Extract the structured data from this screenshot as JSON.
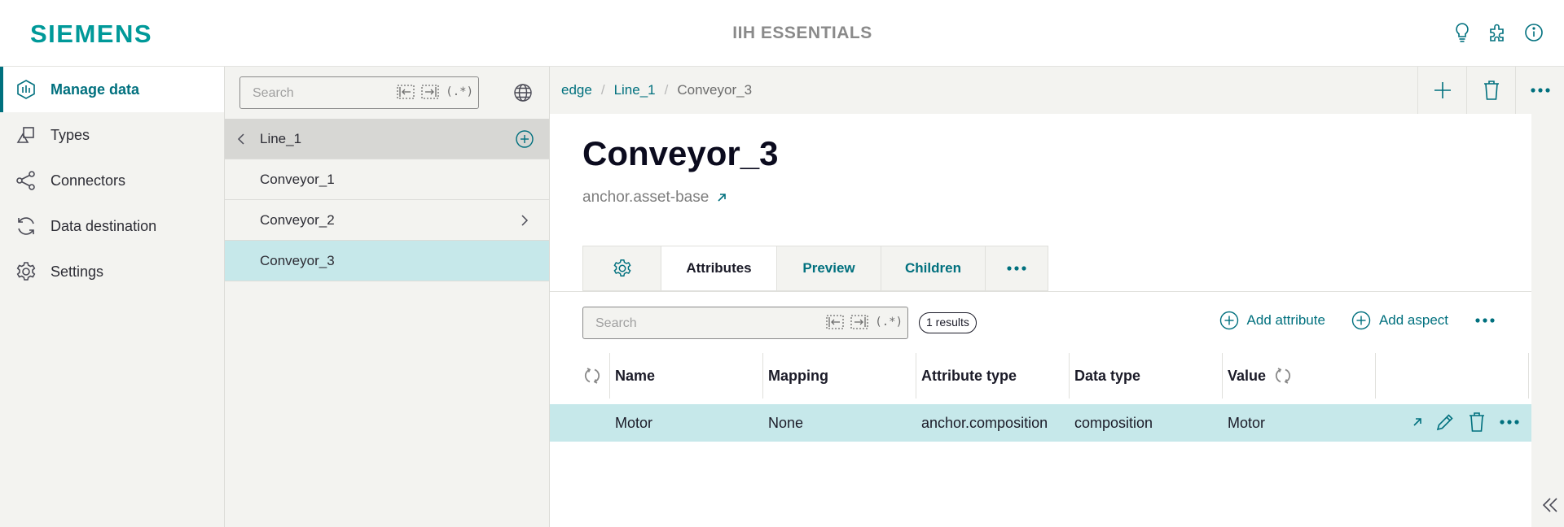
{
  "header": {
    "logo": "SIEMENS",
    "app_title": "IIH ESSENTIALS",
    "icons": [
      "lightbulb-icon",
      "puzzle-icon",
      "info-icon"
    ]
  },
  "nav": {
    "items": [
      {
        "label": "Manage data",
        "icon": "manage-data-icon",
        "active": true
      },
      {
        "label": "Types",
        "icon": "types-icon"
      },
      {
        "label": "Connectors",
        "icon": "connectors-icon"
      },
      {
        "label": "Data destination",
        "icon": "data-destination-icon"
      },
      {
        "label": "Settings",
        "icon": "settings-icon"
      }
    ]
  },
  "tree": {
    "search_placeholder": "Search",
    "regex_label": "(.*)",
    "parent": "Line_1",
    "children": [
      "Conveyor_1",
      "Conveyor_2",
      "Conveyor_3"
    ],
    "selected": "Conveyor_3"
  },
  "breadcrumb": {
    "items": [
      "edge",
      "Line_1",
      "Conveyor_3"
    ],
    "separator": "/"
  },
  "asset": {
    "title": "Conveyor_3",
    "type": "anchor.asset-base"
  },
  "tabs": [
    "Attributes",
    "Preview",
    "Children"
  ],
  "attributes": {
    "search_placeholder": "Search",
    "regex_label": "(.*)",
    "results": "1 results",
    "add_attribute": "Add attribute",
    "add_aspect": "Add aspect",
    "columns": [
      "Name",
      "Mapping",
      "Attribute type",
      "Data type",
      "Value"
    ],
    "rows": [
      {
        "name": "Motor",
        "mapping": "None",
        "attribute_type": "anchor.composition",
        "data_type": "composition",
        "value": "Motor"
      }
    ]
  },
  "colors": {
    "accent": "#00707e",
    "brand": "#009999",
    "selected_row": "#c6e8ea",
    "panel_bg": "#f3f3f0"
  }
}
